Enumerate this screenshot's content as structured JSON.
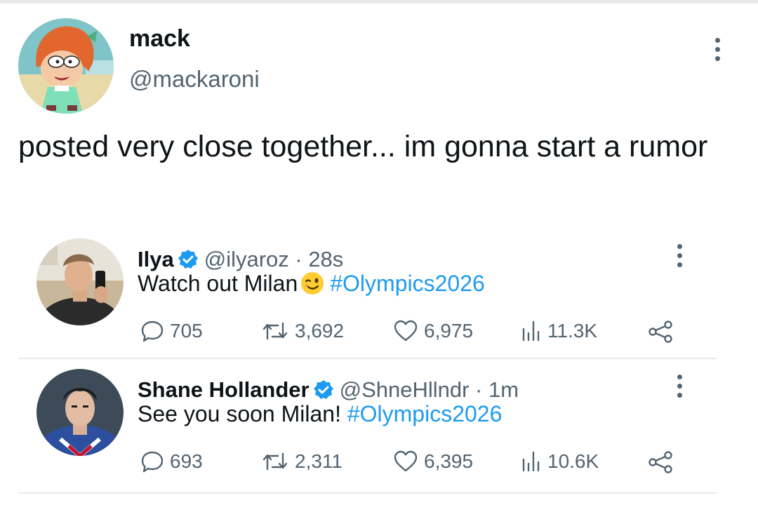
{
  "author": {
    "name": "mack",
    "handle": "@mackaroni",
    "avatar_icon": "cartoon-avatar-icon"
  },
  "tweet": {
    "text": "posted very close together... im gonna start a rumor"
  },
  "quoted": [
    {
      "name": "Ilya",
      "handle": "@ilyaroz · 28s",
      "text_before": "Watch out Milan",
      "emoji": "winking-face-emoji",
      "hashtag": "#Olympics2026",
      "replies": "705",
      "retweets": "3,692",
      "likes": "6,975",
      "views": "11.3K"
    },
    {
      "name": "Shane Hollander",
      "handle": "@ShneHllndr · 1m",
      "text_before": "See you soon Milan!",
      "hashtag": "#Olympics2026",
      "replies": "693",
      "retweets": "2,311",
      "likes": "6,395",
      "views": "10.6K"
    }
  ],
  "colors": {
    "text": "#0f1419",
    "secondary": "#536471",
    "accent": "#1d9bf0",
    "divider": "#e7e9ea"
  }
}
